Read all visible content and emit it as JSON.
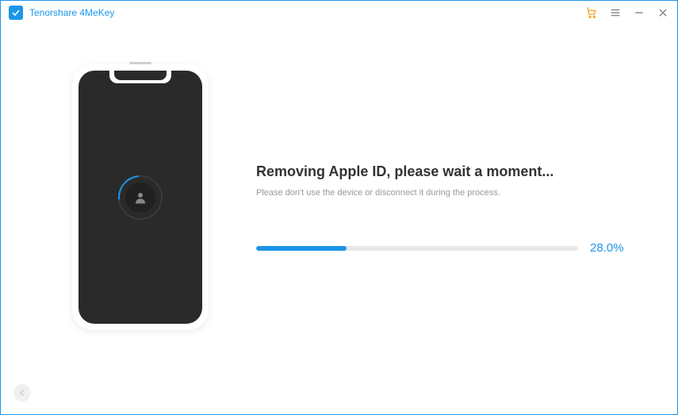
{
  "app": {
    "title": "Tenorshare 4MeKey"
  },
  "main": {
    "heading": "Removing Apple ID, please wait a moment...",
    "subtext": "Please don't use the device or disconnect it during the process.",
    "progress": {
      "value": 28.0,
      "label": "28.0%"
    }
  }
}
